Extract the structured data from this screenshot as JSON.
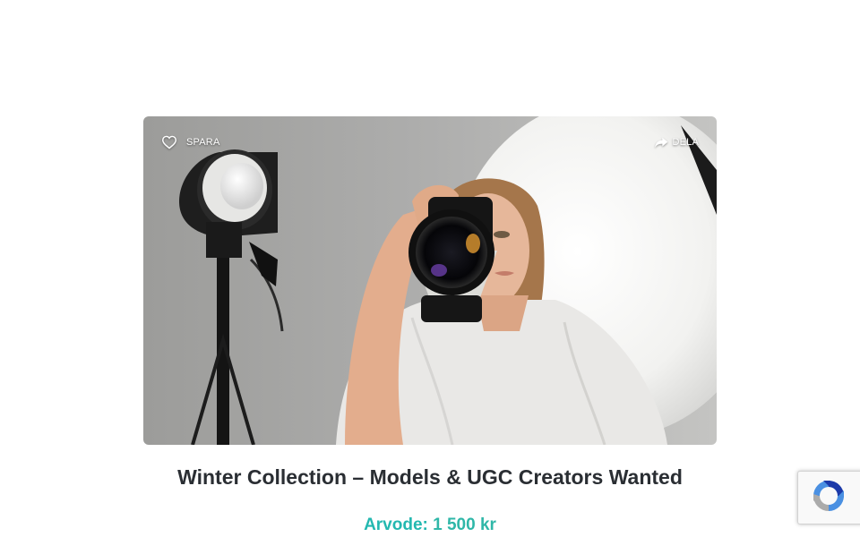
{
  "listing": {
    "save_label": "SPARA",
    "share_label": "DELA",
    "title": "Winter Collection – Models & UGC Creators Wanted",
    "fee_label": "Arvode:",
    "fee_value": "1 500 kr"
  },
  "icons": {
    "save": "heart-outline-icon",
    "share": "share-arrow-icon",
    "recaptcha": "recaptcha-logo-icon"
  },
  "colors": {
    "accent": "#23b8b0",
    "title": "#2a2e33"
  }
}
